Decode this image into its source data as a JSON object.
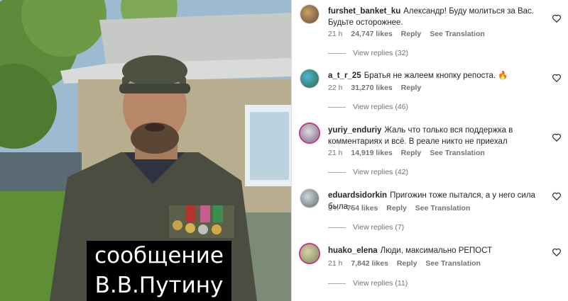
{
  "video": {
    "caption_line1": "сообщение",
    "caption_line2": "В.В.Путину"
  },
  "comments": [
    {
      "username": "furshet_banket_ku",
      "text": "Александр! Буду молиться за Вас. Будьте осторожнее.",
      "time": "21 h",
      "likes": "24,747 likes",
      "reply": "Reply",
      "translation": "See Translation",
      "view_replies": "View replies (32)"
    },
    {
      "username": "a_t_r_25",
      "text": "Братья не жалеем кнопку репоста. 🔥",
      "time": "22 h",
      "likes": "31,270 likes",
      "reply": "Reply",
      "translation": "",
      "view_replies": "View replies (46)"
    },
    {
      "username": "yuriy_enduriy",
      "text": "Жаль что только вся поддержка в комментариях и всё. В реале никто не приехал",
      "time": "21 h",
      "likes": "14,919 likes",
      "reply": "Reply",
      "translation": "See Translation",
      "view_replies": "View replies (42)"
    },
    {
      "username": "eduardsidorkin",
      "text": "Пригожин тоже пытался, а у него сила была .",
      "time": "3 h",
      "likes": "754 likes",
      "reply": "Reply",
      "translation": "See Translation",
      "view_replies": "View replies (7)"
    },
    {
      "username": "huako_elena",
      "text": "Люди, максимально РЕПОСТ",
      "time": "21 h",
      "likes": "7,842 likes",
      "reply": "Reply",
      "translation": "See Translation",
      "view_replies": "View replies (11)"
    }
  ],
  "colors": {
    "text": "#262626",
    "secondary": "#737373",
    "story_ring": "#c13584"
  }
}
